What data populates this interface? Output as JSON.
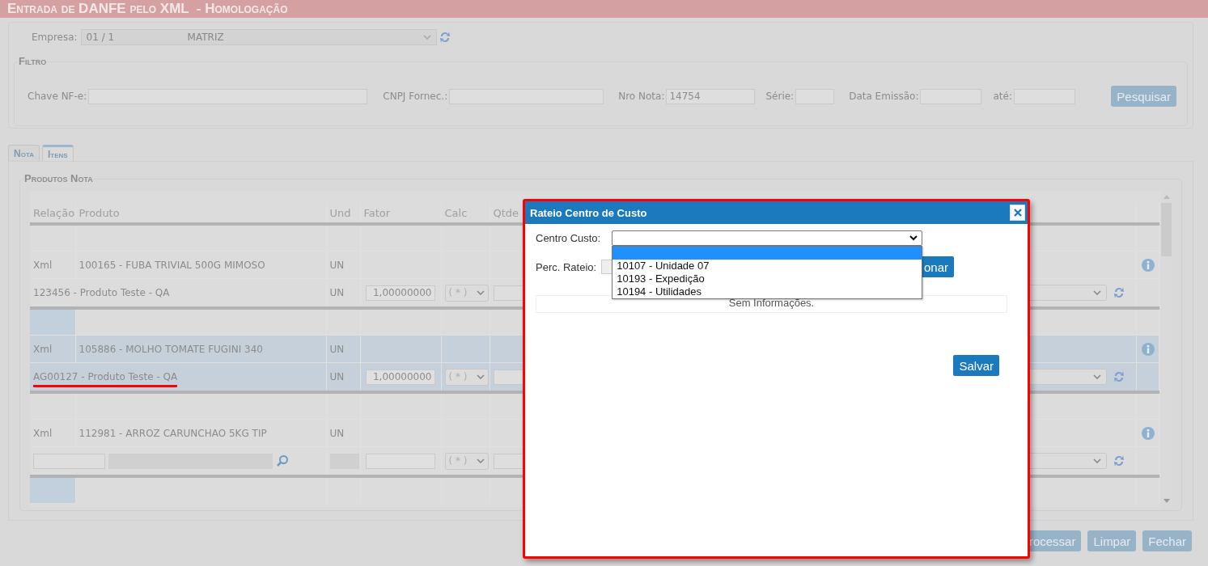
{
  "window": {
    "title": "Entrada de DANFE pelo XML  - Homologação"
  },
  "empresa": {
    "label": "Empresa:",
    "code": "01 / 1",
    "name": "MATRIZ"
  },
  "filter": {
    "legend": "Filtro",
    "fields": [
      {
        "label": "Chave NF-e:"
      },
      {
        "label": "CNPJ Fornec.:"
      },
      {
        "label": "Nro Nota:",
        "value": "14754"
      },
      {
        "label": "Série:"
      },
      {
        "label": "Data Emissão:"
      },
      {
        "label": "até:"
      }
    ],
    "search_button": "Pesquisar"
  },
  "tabs": [
    {
      "label": "Nota",
      "selected": false
    },
    {
      "label": "Itens",
      "selected": true
    }
  ],
  "products": {
    "legend": "Produtos Nota",
    "columns": [
      "Relação",
      "Produto",
      "Und",
      "Fator",
      "Calc",
      "Qtde"
    ],
    "groups": [
      {
        "selected": false,
        "tagged": false,
        "xml": {
          "relation": "Xml",
          "product": "100165 - FUBA TRIVIAL 500G MIMOSO",
          "unit": "UN"
        },
        "item": {
          "kind": "linked",
          "product": "123456 - Produto Teste - QA",
          "unit": "UN",
          "factor": "1,00000000",
          "calc": "( * )",
          "underlined": false
        }
      },
      {
        "selected": true,
        "tagged": true,
        "xml": {
          "relation": "Xml",
          "product": "105886 - MOLHO TOMATE FUGINI 340",
          "unit": "UN"
        },
        "item": {
          "kind": "linked",
          "product": "AG00127 - Produto Teste - QA",
          "unit": "UN",
          "factor": "1,00000000",
          "calc": "( * )",
          "underlined": true
        }
      },
      {
        "selected": false,
        "tagged": false,
        "xml": {
          "relation": "Xml",
          "product": "112981 - ARROZ CARUNCHAO 5KG TIP",
          "unit": "UN"
        },
        "item": {
          "kind": "unlinked",
          "calc": "( * )"
        }
      },
      {
        "selected": false,
        "tagged": true
      }
    ]
  },
  "buttons": [
    "rocessar",
    "Limpar",
    "Fechar"
  ],
  "dialog": {
    "title": "Rateio Centro de Custo",
    "cost_center": {
      "label": "Centro Custo:",
      "expanded": true,
      "options": [
        {
          "selected": true
        },
        {
          "label": "10107 - Unidade 07",
          "selected": false
        },
        {
          "label": "10193 - Expedição",
          "selected": false
        },
        {
          "label": "10194 - Utilidades",
          "selected": false
        }
      ]
    },
    "percent": {
      "label": "Perc. Rateio:"
    },
    "add_button": "onar",
    "empty_text": "Sem Informações.",
    "save_button": "Salvar"
  }
}
